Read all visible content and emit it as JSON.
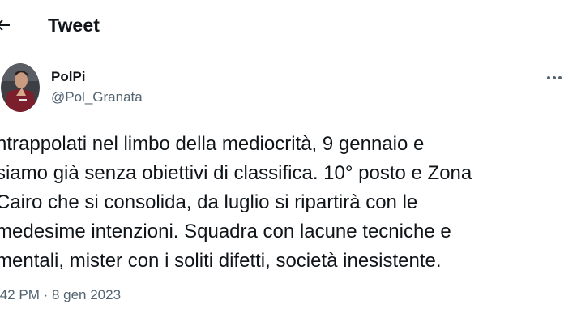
{
  "header": {
    "title": "Tweet",
    "back_icon": "arrow-left-icon"
  },
  "author": {
    "name": "PolPi",
    "handle": "@Pol_Granata",
    "avatar": "player-photo-avatar"
  },
  "tweet": {
    "text": "ntrappolati nel limbo della mediocrità, 9 gennaio e\nsiamo già senza obiettivi di classifica. 10° posto e Zona\nCairo che si consolida, da luglio si ripartirà con le\nmedesime intenzioni. Squadra con lacune tecniche e\nmentali, mister con i soliti difetti, società inesistente.",
    "meta": ":42 PM · 8 gen 2023"
  },
  "more_icon": "more-horizontal-icon",
  "colors": {
    "text_primary": "#0f1419",
    "text_secondary": "#536471",
    "avatar_jersey": "#7a1f2b"
  }
}
